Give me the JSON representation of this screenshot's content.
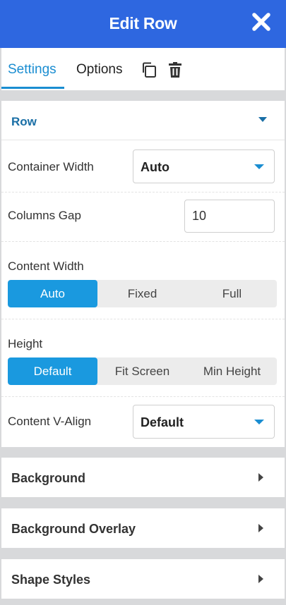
{
  "header": {
    "title": "Edit Row",
    "close_icon": "close-icon",
    "background": "#2e67e0"
  },
  "tabs": {
    "settings_label": "Settings",
    "options_label": "Options",
    "icons": [
      "copy-icon",
      "trash-icon"
    ],
    "active": "Settings"
  },
  "row_section": {
    "title": "Row",
    "container_width": {
      "label": "Container Width",
      "value": "Auto"
    },
    "columns_gap": {
      "label": "Columns Gap",
      "value": "10"
    },
    "content_width": {
      "label": "Content Width",
      "options": [
        "Auto",
        "Fixed",
        "Full"
      ],
      "selected": "Auto"
    },
    "height": {
      "label": "Height",
      "options": [
        "Default",
        "Fit Screen",
        "Min Height"
      ],
      "selected": "Default"
    },
    "content_valign": {
      "label": "Content V-Align",
      "value": "Default"
    }
  },
  "collapsed_sections": [
    "Background",
    "Background Overlay",
    "Shape Styles"
  ],
  "colors": {
    "accent": "#1a99df",
    "header": "#2e67e0"
  }
}
